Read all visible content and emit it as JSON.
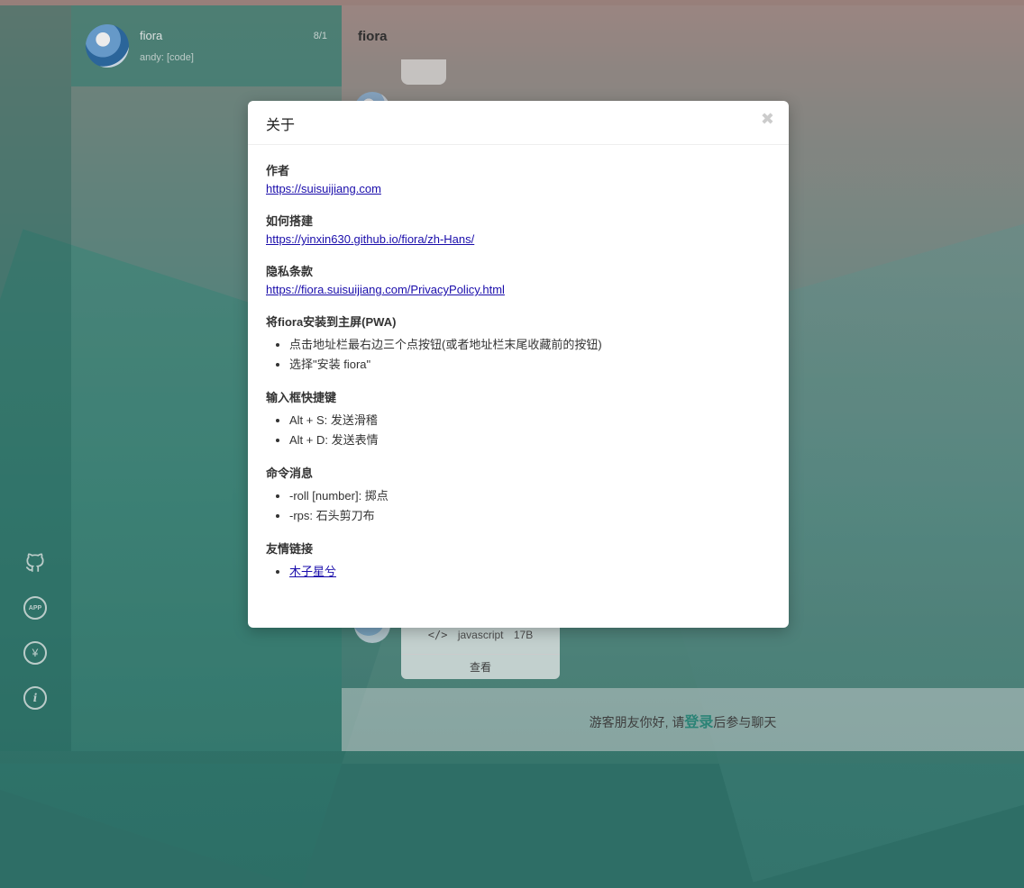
{
  "sidebar": {
    "icons": [
      "github-icon",
      "app-icon",
      "yen-icon",
      "info-icon"
    ],
    "app_icon_label": "APP",
    "yen_symbol": "¥",
    "info_symbol": "i"
  },
  "list": {
    "item": {
      "name": "fiora",
      "time": "8/1",
      "last_message": "andy: [code]"
    }
  },
  "chat": {
    "title": "fiora",
    "code_card": {
      "icon": "</>",
      "lang": "javascript",
      "size": "17B",
      "view_label": "查看"
    },
    "footer": {
      "before": "游客朋友你好, 请",
      "login": "登录",
      "after": "后参与聊天"
    }
  },
  "modal": {
    "title": "关于",
    "close": "✖",
    "sections": {
      "author": {
        "title": "作者",
        "link": "https://suisuijiang.com"
      },
      "build": {
        "title": "如何搭建",
        "link": "https://yinxin630.github.io/fiora/zh-Hans/"
      },
      "privacy": {
        "title": "隐私条款",
        "link": "https://fiora.suisuijiang.com/PrivacyPolicy.html"
      },
      "pwa": {
        "title": "将fiora安装到主屏(PWA)",
        "items": [
          "点击地址栏最右边三个点按钮(或者地址栏末尾收藏前的按钮)",
          "选择\"安装 fiora\""
        ]
      },
      "shortcuts": {
        "title": "输入框快捷键",
        "items": [
          "Alt + S: 发送滑稽",
          "Alt + D: 发送表情"
        ]
      },
      "commands": {
        "title": "命令消息",
        "items": [
          "-roll [number]: 掷点",
          "-rps: 石头剪刀布"
        ]
      },
      "friends": {
        "title": "友情链接",
        "items": [
          "木子星兮"
        ]
      }
    }
  }
}
